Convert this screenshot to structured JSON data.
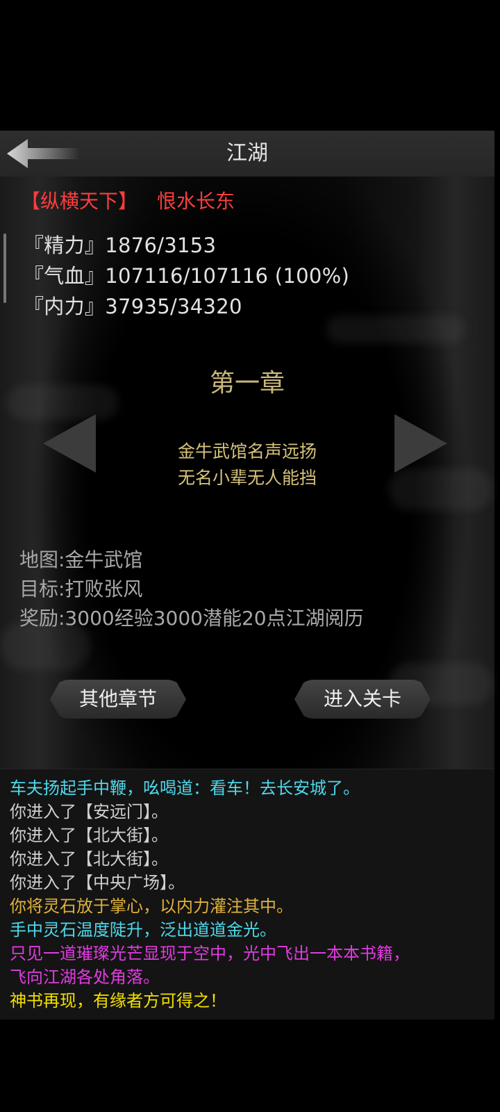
{
  "header": {
    "title": "江湖"
  },
  "player": {
    "sect": "【纵横天下】",
    "name": "恨水长东"
  },
  "stats": [
    "『精力』1876/3153",
    "『气血』107116/107116 (100%)",
    "『内力』37935/34320"
  ],
  "chapter": {
    "title": "第一章",
    "desc_lines": [
      "金牛武馆名声远扬",
      "无名小辈无人能挡"
    ],
    "map": "地图:金牛武馆",
    "goal": "目标:打败张风",
    "reward": "奖励:3000经验3000潜能20点江湖阅历"
  },
  "buttons": {
    "other_chapters": "其他章节",
    "enter_level": "进入关卡"
  },
  "log": [
    {
      "text": "车夫扬起手中鞭，吆喝道：看车！去长安城了。",
      "color": "#4fd8ea"
    },
    {
      "text": "你进入了【安远门】。",
      "color": "#d0d0d0"
    },
    {
      "text": "你进入了【北大街】。",
      "color": "#d0d0d0"
    },
    {
      "text": "你进入了【北大街】。",
      "color": "#d0d0d0"
    },
    {
      "text": "你进入了【中央广场】。",
      "color": "#d0d0d0"
    },
    {
      "text": "你将灵石放于掌心，以内力灌注其中。",
      "color": "#e0b23c"
    },
    {
      "text": "手中灵石温度陡升，泛出道道金光。",
      "color": "#4fd8ea"
    },
    {
      "text": "只见一道璀璨光芒显现于空中，光中飞出一本本书籍，",
      "color": "#e23be0"
    },
    {
      "text": "飞向江湖各处角落。",
      "color": "#e23be0"
    },
    {
      "text": "神书再现，有缘者方可得之！",
      "color": "#f3e000"
    }
  ]
}
